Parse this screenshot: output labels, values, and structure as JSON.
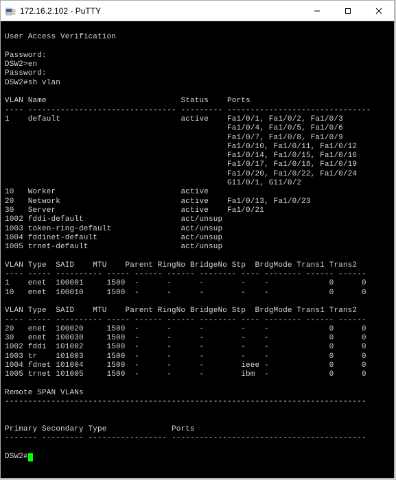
{
  "window": {
    "title": "172.16.2.102 - PuTTY",
    "minimize": "–",
    "maximize": "□",
    "close": "×"
  },
  "session": {
    "banner": "User Access Verification",
    "pw_prompt1": "Password:",
    "prompt1": "DSW2>en",
    "pw_prompt2": "Password:",
    "prompt2": "DSW2#sh vlan",
    "final_prompt": "DSW2#"
  },
  "vlan_brief": {
    "hdr_vlan": "VLAN",
    "hdr_name": "Name",
    "hdr_status": "Status",
    "hdr_ports": "Ports",
    "rows": [
      {
        "vlan": "1",
        "name": "default",
        "status": "active",
        "ports": "Fa1/0/1, Fa1/0/2, Fa1/0/3"
      },
      {
        "vlan": "",
        "name": "",
        "status": "",
        "ports": "Fa1/0/4, Fa1/0/5, Fa1/0/6"
      },
      {
        "vlan": "",
        "name": "",
        "status": "",
        "ports": "Fa1/0/7, Fa1/0/8, Fa1/0/9"
      },
      {
        "vlan": "",
        "name": "",
        "status": "",
        "ports": "Fa1/0/10, Fa1/0/11, Fa1/0/12"
      },
      {
        "vlan": "",
        "name": "",
        "status": "",
        "ports": "Fa1/0/14, Fa1/0/15, Fa1/0/16"
      },
      {
        "vlan": "",
        "name": "",
        "status": "",
        "ports": "Fa1/0/17, Fa1/0/18, Fa1/0/19"
      },
      {
        "vlan": "",
        "name": "",
        "status": "",
        "ports": "Fa1/0/20, Fa1/0/22, Fa1/0/24"
      },
      {
        "vlan": "",
        "name": "",
        "status": "",
        "ports": "Gi1/0/1, Gi1/0/2"
      },
      {
        "vlan": "10",
        "name": "Worker",
        "status": "active",
        "ports": ""
      },
      {
        "vlan": "20",
        "name": "Network",
        "status": "active",
        "ports": "Fa1/0/13, Fa1/0/23"
      },
      {
        "vlan": "30",
        "name": "Server",
        "status": "active",
        "ports": "Fa1/0/21"
      },
      {
        "vlan": "1002",
        "name": "fddi-default",
        "status": "act/unsup",
        "ports": ""
      },
      {
        "vlan": "1003",
        "name": "token-ring-default",
        "status": "act/unsup",
        "ports": ""
      },
      {
        "vlan": "1004",
        "name": "fddinet-default",
        "status": "act/unsup",
        "ports": ""
      },
      {
        "vlan": "1005",
        "name": "trnet-default",
        "status": "act/unsup",
        "ports": ""
      }
    ]
  },
  "vlan_detail": {
    "hdr_vlan": "VLAN",
    "hdr_type": "Type",
    "hdr_said": "SAID",
    "hdr_mtu": "MTU",
    "hdr_parent": "Parent",
    "hdr_ringno": "RingNo",
    "hdr_bridgeno": "BridgeNo",
    "hdr_stp": "Stp",
    "hdr_brdgmode": "BrdgMode",
    "hdr_trans1": "Trans1",
    "hdr_trans2": "Trans2",
    "group1": [
      {
        "vlan": "1",
        "type": "enet",
        "said": "100001",
        "mtu": "1500",
        "parent": "-",
        "ringno": "-",
        "bridgeno": "-",
        "stp": "-",
        "brdgmode": "-",
        "trans1": "0",
        "trans2": "0"
      },
      {
        "vlan": "10",
        "type": "enet",
        "said": "100010",
        "mtu": "1500",
        "parent": "-",
        "ringno": "-",
        "bridgeno": "-",
        "stp": "-",
        "brdgmode": "-",
        "trans1": "0",
        "trans2": "0"
      }
    ],
    "group2": [
      {
        "vlan": "20",
        "type": "enet",
        "said": "100020",
        "mtu": "1500",
        "parent": "-",
        "ringno": "-",
        "bridgeno": "-",
        "stp": "-",
        "brdgmode": "-",
        "trans1": "0",
        "trans2": "0"
      },
      {
        "vlan": "30",
        "type": "enet",
        "said": "100030",
        "mtu": "1500",
        "parent": "-",
        "ringno": "-",
        "bridgeno": "-",
        "stp": "-",
        "brdgmode": "-",
        "trans1": "0",
        "trans2": "0"
      },
      {
        "vlan": "1002",
        "type": "fddi",
        "said": "101002",
        "mtu": "1500",
        "parent": "-",
        "ringno": "-",
        "bridgeno": "-",
        "stp": "-",
        "brdgmode": "-",
        "trans1": "0",
        "trans2": "0"
      },
      {
        "vlan": "1003",
        "type": "tr",
        "said": "101003",
        "mtu": "1500",
        "parent": "-",
        "ringno": "-",
        "bridgeno": "-",
        "stp": "-",
        "brdgmode": "-",
        "trans1": "0",
        "trans2": "0"
      },
      {
        "vlan": "1004",
        "type": "fdnet",
        "said": "101004",
        "mtu": "1500",
        "parent": "-",
        "ringno": "-",
        "bridgeno": "-",
        "stp": "ieee",
        "brdgmode": "-",
        "trans1": "0",
        "trans2": "0"
      },
      {
        "vlan": "1005",
        "type": "trnet",
        "said": "101005",
        "mtu": "1500",
        "parent": "-",
        "ringno": "-",
        "bridgeno": "-",
        "stp": "ibm",
        "brdgmode": "-",
        "trans1": "0",
        "trans2": "0"
      }
    ]
  },
  "rspan": {
    "title": "Remote SPAN VLANs",
    "hdr_primary": "Primary",
    "hdr_secondary": "Secondary",
    "hdr_type": "Type",
    "hdr_ports": "Ports"
  }
}
